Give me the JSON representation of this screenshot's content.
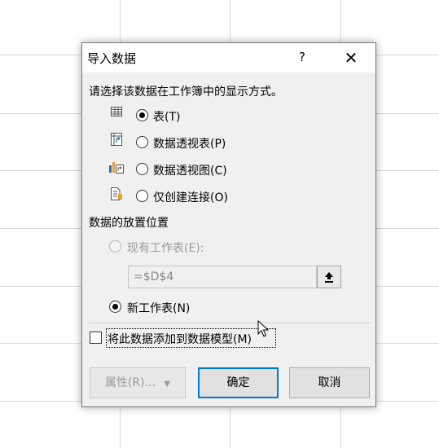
{
  "dialog": {
    "title": "导入数据",
    "help": "?",
    "close": "✕",
    "display_prompt": "请选择该数据在工作簿中的显示方式。",
    "display_options": [
      {
        "label": "表(T)",
        "checked": true,
        "icon": "table-icon"
      },
      {
        "label": "数据透视表(P)",
        "checked": false,
        "icon": "pivot-table-icon"
      },
      {
        "label": "数据透视图(C)",
        "checked": false,
        "icon": "pivot-chart-icon"
      },
      {
        "label": "仅创建连接(O)",
        "checked": false,
        "icon": "connection-only-icon"
      }
    ],
    "placement_heading": "数据的放置位置",
    "existing_sheet_label": "现有工作表(E):",
    "existing_sheet_ref": "=$D$4",
    "collapse_icon": "collapse-dialog-icon",
    "new_sheet_label": "新工作表(N)",
    "new_sheet_checked": true,
    "data_model_label": "将此数据添加到数据模型(M)",
    "data_model_checked": false,
    "properties_button": "属性(R)...",
    "ok_button": "确定",
    "cancel_button": "取消"
  },
  "colors": {
    "accent": "#0078d7",
    "dialog_bg": "#f0f0f0",
    "grid": "#d9d9d9",
    "disabled_text": "#9a9a9a"
  }
}
